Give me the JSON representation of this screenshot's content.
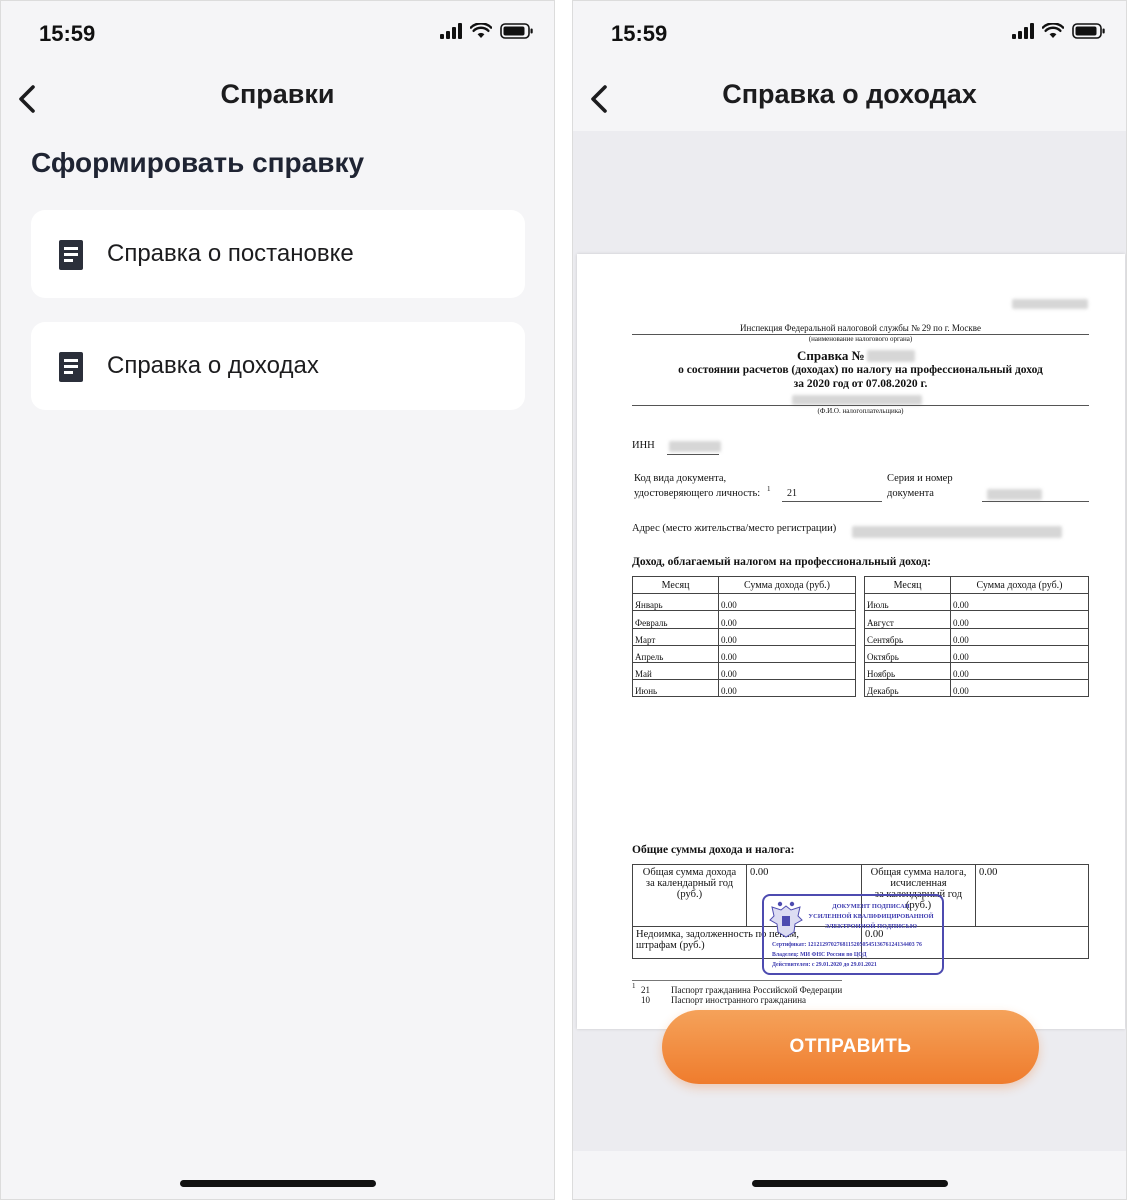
{
  "colors": {
    "accent": "#ef7c2d",
    "stamp": "#3e3cb0",
    "background": "#f5f5f7",
    "card": "#ffffff"
  },
  "status_bar": {
    "time": "15:59"
  },
  "left_screen": {
    "title": "Справки",
    "back_icon": "chevron-left-icon",
    "section_title": "Сформировать справку",
    "items": [
      {
        "label": "Справка о постановке",
        "icon": "document-icon"
      },
      {
        "label": "Справка о доходах",
        "icon": "document-icon"
      }
    ]
  },
  "right_screen": {
    "title": "Справка о доходах",
    "back_icon": "chevron-left-icon",
    "send_button": "ОТПРАВИТЬ",
    "document": {
      "inspection": "Инспекция Федеральной налоговой службы № 29 по г. Москве",
      "inspection_caption": "(наименование налогового органа)",
      "heading_1": "Справка №",
      "heading_2": "о состоянии расчетов (доходах) по налогу на профессиональный доход",
      "heading_3": "за 2020 год от 07.08.2020 г.",
      "fio_caption": "(Ф.И.О. налогоплательщика)",
      "inn_label": "ИНН",
      "doc_code_label_1": "Код вида документа,",
      "doc_code_label_2": "удостоверяющего личность:",
      "doc_code_sup": "1",
      "doc_code_value": "21",
      "series_label_1": "Серия и номер",
      "series_label_2": "документа",
      "address_label": "Адрес (место жительства/место регистрации)",
      "income_heading": "Доход, облагаемый налогом на профессиональный доход:",
      "col_month": "Месяц",
      "col_sum": "Сумма дохода (руб.)",
      "months_left": [
        {
          "month": "Январь",
          "value": "0.00"
        },
        {
          "month": "Февраль",
          "value": "0.00"
        },
        {
          "month": "Март",
          "value": "0.00"
        },
        {
          "month": "Апрель",
          "value": "0.00"
        },
        {
          "month": "Май",
          "value": "0.00"
        },
        {
          "month": "Июнь",
          "value": "0.00"
        }
      ],
      "months_right": [
        {
          "month": "Июль",
          "value": "0.00"
        },
        {
          "month": "Август",
          "value": "0.00"
        },
        {
          "month": "Сентябрь",
          "value": "0.00"
        },
        {
          "month": "Октябрь",
          "value": "0.00"
        },
        {
          "month": "Ноябрь",
          "value": "0.00"
        },
        {
          "month": "Декабрь",
          "value": "0.00"
        }
      ],
      "totals_heading": "Общие суммы дохода и налога:",
      "total_income_label_1": "Общая сумма дохода",
      "total_income_label_2": "за календарный год",
      "total_income_label_3": "(руб.)",
      "total_income_value": "0.00",
      "total_tax_label_1": "Общая сумма налога,",
      "total_tax_label_2": "исчисленная",
      "total_tax_label_3": "за календарный год",
      "total_tax_label_4": "(руб.)",
      "total_tax_value": "0.00",
      "arrears_label_1": "Недоимка, задолженность по пеням,",
      "arrears_label_2": "штрафам (руб.)",
      "arrears_value": "0.00",
      "stamp": {
        "line1": "ДОКУМЕНТ ПОДПИСАН",
        "line2": "УСИЛЕННОЙ КВАЛИФИЦИРОВАННОЙ",
        "line3": "ЭЛЕКТРОННОЙ ПОДПИСЬЮ",
        "certificate": "Сертификат: 1212129702768115205054513676124134403 76",
        "owner": "Владелец: МИ ФНС России по ЦОД",
        "valid": "Действителен: с 29.01.2020 до 29.01.2021"
      },
      "footnotes": [
        {
          "sup": "1",
          "code": "21",
          "text": "Паспорт гражданина Российской Федерации"
        },
        {
          "sup": "",
          "code": "10",
          "text": "Паспорт иностранного гражданина"
        }
      ]
    }
  }
}
